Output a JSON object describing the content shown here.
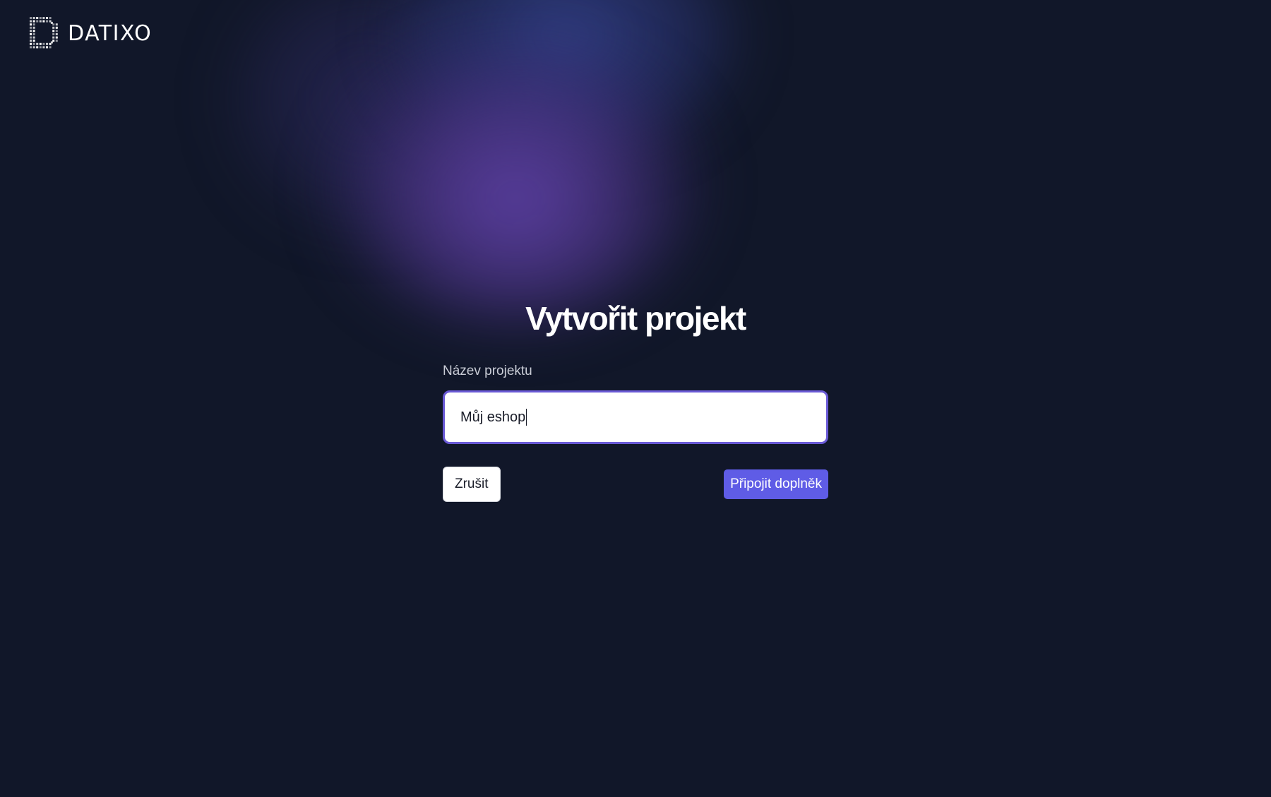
{
  "brand": {
    "name": "DATIXO",
    "logo_icon": "datixo-dotted-d-icon"
  },
  "form": {
    "title": "Vytvořit projekt",
    "project_name_label": "Název projektu",
    "project_name_value": "Můj eshop"
  },
  "actions": {
    "cancel_label": "Zrušit",
    "connect_label": "Připojit doplněk"
  },
  "colors": {
    "background": "#111729",
    "primary_button": "#5f5ce6",
    "input_focus_border": "#6a5ad6",
    "glow_purple": "#6042aa",
    "glow_blue": "#34428c"
  }
}
